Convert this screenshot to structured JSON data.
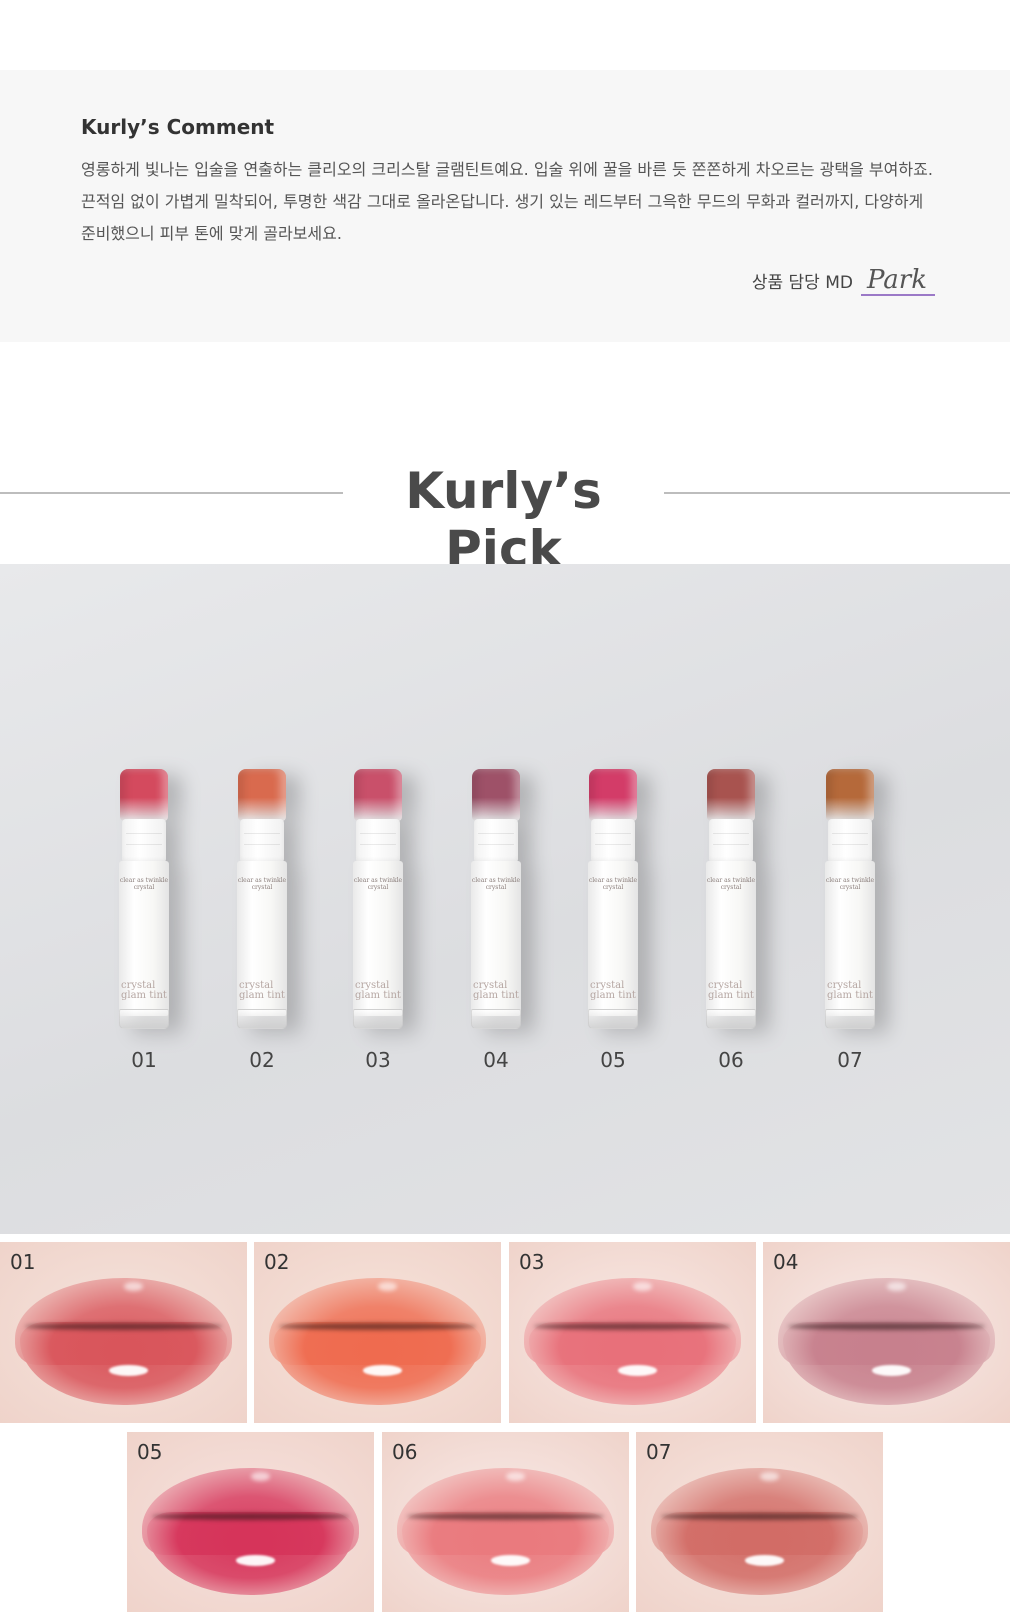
{
  "comment": {
    "title": "Kurly’s Comment",
    "body": "영롱하게 빛나는 입술을 연출하는 클리오의 크리스탈 글램틴트예요. 입술 위에 꿀을 바른 듯 쫀쫀하게 차오르는 광택을 부여하죠. 끈적임 없이 가볍게 밀착되어, 투명한 색감 그대로 올라온답니다. 생기 있는 레드부터 그윽한 무드의 무화과 컬러까지, 다양하게 준비했으니 피부 톤에 맞게 골라보세요.",
    "md_label": "상품 담당 MD",
    "md_name": "Park"
  },
  "pick": {
    "title": "Kurly’s Pick"
  },
  "products": {
    "small_text": "clear as twinkle crystal",
    "brand_text": "crystal glam tint",
    "items": [
      {
        "label": "01",
        "cap_color": "#d44a5e"
      },
      {
        "label": "02",
        "cap_color": "#d96a4e"
      },
      {
        "label": "03",
        "cap_color": "#c9506a"
      },
      {
        "label": "04",
        "cap_color": "#9e5168"
      },
      {
        "label": "05",
        "cap_color": "#d33c68"
      },
      {
        "label": "06",
        "cap_color": "#a8534f"
      },
      {
        "label": "07",
        "cap_color": "#b5693a"
      }
    ]
  },
  "swatches": [
    {
      "label": "01",
      "color": "#d9555b",
      "bg": "#f3ddd5"
    },
    {
      "label": "02",
      "color": "#ef6b4f",
      "bg": "#f4ddd4"
    },
    {
      "label": "03",
      "color": "#e8707a",
      "bg": "#f5e0da"
    },
    {
      "label": "04",
      "color": "#c7808d",
      "bg": "#f5e2dd"
    },
    {
      "label": "05",
      "color": "#d6345a",
      "bg": "#f4dcd6"
    },
    {
      "label": "06",
      "color": "#ea7a7e",
      "bg": "#f5e1dc"
    },
    {
      "label": "07",
      "color": "#d26c66",
      "bg": "#f4ded7"
    }
  ]
}
